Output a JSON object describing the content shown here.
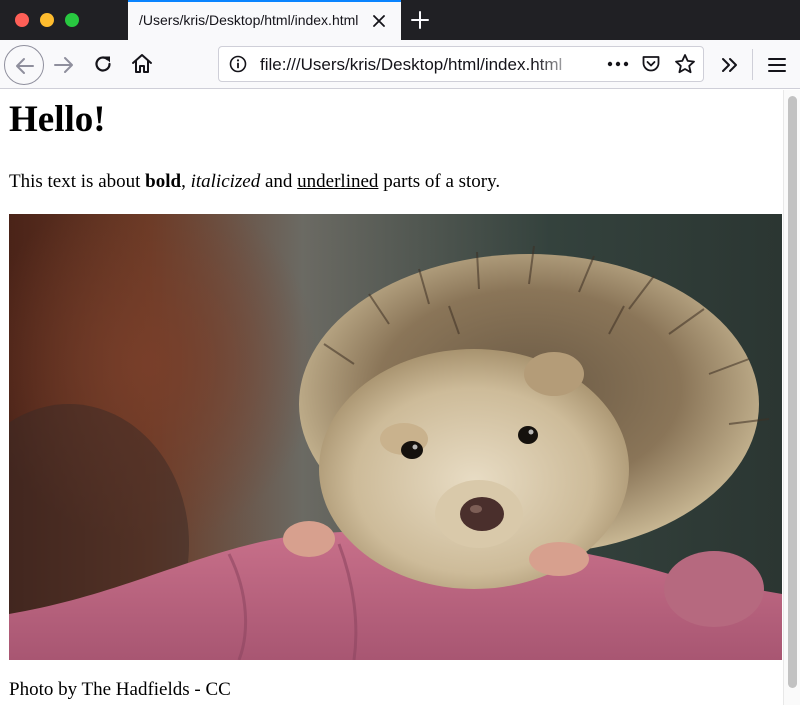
{
  "browser": {
    "tab": {
      "title": "/Users/kris/Desktop/html/index.html"
    },
    "address_bar": {
      "url": "file:///Users/kris/Desktop/html/index.html"
    },
    "icons": {
      "back": "arrow-left-icon",
      "forward": "arrow-right-icon",
      "reload": "reload-icon",
      "home": "home-icon",
      "page_info": "info-icon",
      "page_actions": "more-horizontal-icon",
      "pocket": "pocket-icon",
      "bookmark": "star-icon",
      "overflow": "chevron-double-right-icon",
      "menu": "hamburger-menu-icon",
      "close_tab": "close-icon",
      "new_tab": "plus-icon"
    },
    "colors": {
      "tab_strip": "#202024",
      "active_tab_accent": "#0a84ff",
      "toolbar": "#f9f9fb",
      "close_button": "#fe5f57",
      "minimize_button": "#febc2e",
      "zoom_button": "#28c840"
    }
  },
  "page": {
    "heading": "Hello!",
    "paragraph": {
      "prefix": "This text is about ",
      "bold": "bold",
      "sep1": ", ",
      "italic": "italicized",
      "sep2": " and ",
      "underline": "underlined",
      "suffix": " parts of a story."
    },
    "image": {
      "subject": "hedgehog-photo"
    },
    "caption": "Photo by The Hadfields - CC"
  }
}
